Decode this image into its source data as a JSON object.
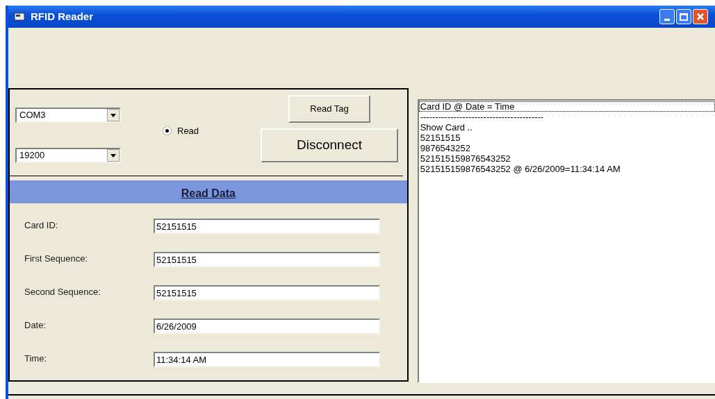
{
  "window": {
    "title": "RFID Reader"
  },
  "ports": [
    {
      "value": "COM3"
    },
    {
      "value": "19200"
    }
  ],
  "mode": {
    "label": "Read",
    "selected": true
  },
  "buttons": {
    "read_tag": "Read Tag",
    "disconnect": "Disconnect"
  },
  "section_title": "Read Data",
  "fields": [
    {
      "label": "Card ID:",
      "value": "52151515"
    },
    {
      "label": "First Sequence:",
      "value": "52151515"
    },
    {
      "label": "Second Sequence:",
      "value": "52151515"
    },
    {
      "label": "Date:",
      "value": "6/26/2009"
    },
    {
      "label": "Time:",
      "value": "11:34:14 AM"
    }
  ],
  "log": [
    {
      "text": "Card ID  @  Date  =  Time",
      "selected": true
    },
    {
      "text": "-----------------------------------------",
      "selected": false
    },
    {
      "text": "Show Card ..",
      "selected": false
    },
    {
      "text": "52151515",
      "selected": false
    },
    {
      "text": "9876543252",
      "selected": false
    },
    {
      "text": "521515159876543252",
      "selected": false
    },
    {
      "text": "521515159876543252 @ 6/26/2009=11:34:14 AM",
      "selected": false
    }
  ]
}
